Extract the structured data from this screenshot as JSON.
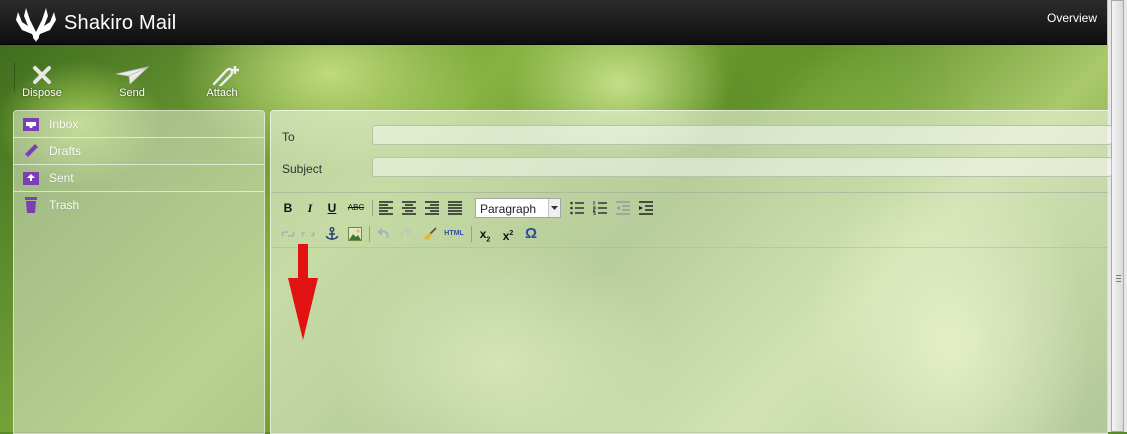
{
  "app": {
    "title": "Shakiro Mail",
    "logo_icon": "antlers-logo-icon"
  },
  "header": {
    "overview_label": "Overview"
  },
  "toolbar": [
    {
      "label": "Dispose",
      "icon": "x-icon"
    },
    {
      "label": "Send",
      "icon": "paper-plane-icon"
    },
    {
      "label": "Attach",
      "icon": "paperclip-plus-icon"
    }
  ],
  "sidebar": {
    "items": [
      {
        "label": "Inbox",
        "icon": "inbox-tray-icon"
      },
      {
        "label": "Drafts",
        "icon": "pencil-icon"
      },
      {
        "label": "Sent",
        "icon": "sent-tray-icon"
      },
      {
        "label": "Trash",
        "icon": "trash-icon"
      }
    ]
  },
  "compose": {
    "to": {
      "label": "To",
      "value": ""
    },
    "subject": {
      "label": "Subject",
      "value": ""
    },
    "format_select": {
      "value": "Paragraph"
    },
    "bold": "B",
    "italic": "I",
    "underline": "U",
    "strike": "ABC",
    "html": "HTML",
    "omega": "Ω"
  },
  "colors": {
    "accent_purple": "#7b3fb5",
    "arrow_red": "#e01010",
    "topbar": "#1a1a1a"
  }
}
